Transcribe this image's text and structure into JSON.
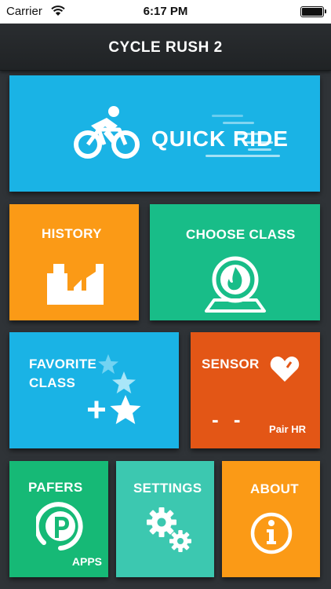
{
  "status_bar": {
    "carrier": "Carrier",
    "time": "6:17 PM"
  },
  "nav": {
    "title": "CYCLE RUSH 2"
  },
  "tiles": {
    "quick_ride": {
      "label": "QUICK RIDE",
      "color": "#1ab3e5",
      "icon": "cyclist-icon"
    },
    "history": {
      "label": "HISTORY",
      "color": "#fb9a16",
      "icon": "history-chart-icon"
    },
    "choose_class": {
      "label": "CHOOSE CLASS",
      "color": "#18bd88",
      "icon": "class-flame-icon"
    },
    "favorite_class": {
      "label_line1": "FAVORITE",
      "label_line2": "CLASS",
      "color": "#1ab3e5",
      "icon": "add-star-icon"
    },
    "sensor": {
      "label": "SENSOR",
      "value": "- -",
      "action": "Pair HR",
      "color": "#e35616",
      "icon": "heart-icon"
    },
    "pafers": {
      "label": "PAFERS",
      "sublabel": "APPS",
      "color": "#16b976",
      "icon": "pafers-logo-icon"
    },
    "settings": {
      "label": "SETTINGS",
      "color": "#3cc8b0",
      "icon": "gears-icon"
    },
    "about": {
      "label": "ABOUT",
      "color": "#fb9a16",
      "icon": "info-icon"
    }
  }
}
